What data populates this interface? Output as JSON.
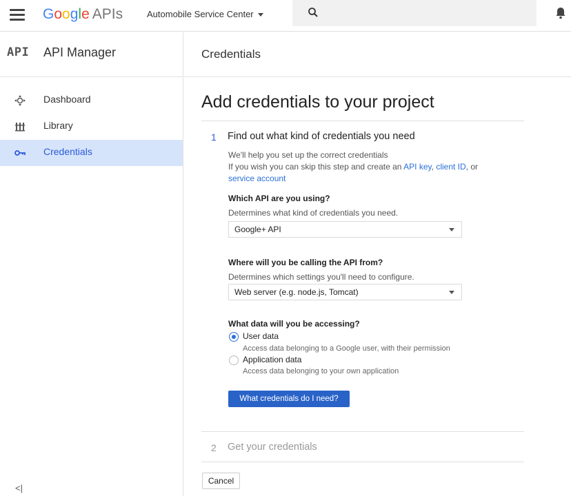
{
  "topbar": {
    "logo_google": "Google",
    "logo_apis": "APIs",
    "project_name": "Automobile Service Center"
  },
  "sidebar": {
    "logo_text": "API",
    "title": "API Manager",
    "items": [
      {
        "label": "Dashboard",
        "icon": "dashboard-icon",
        "active": false
      },
      {
        "label": "Library",
        "icon": "library-icon",
        "active": false
      },
      {
        "label": "Credentials",
        "icon": "key-icon",
        "active": true
      }
    ],
    "collapse_label": "<|"
  },
  "main": {
    "header_title": "Credentials",
    "page_title": "Add credentials to your project",
    "step1": {
      "number": "1",
      "title": "Find out what kind of credentials you need",
      "intro_line1": "We'll help you set up the correct credentials",
      "intro_line2_prefix": "If you wish you can skip this step and create an ",
      "link_api_key": "API key",
      "sep_comma": ",",
      "link_client_id": "client ID",
      "sep_or": ", or",
      "link_service_account": "service account",
      "q1_title": "Which API are you using?",
      "q1_desc": "Determines what kind of credentials you need.",
      "q1_value": "Google+ API",
      "q2_title": "Where will you be calling the API from?",
      "q2_desc": "Determines which settings you'll need to configure.",
      "q2_value": "Web server (e.g. node.js, Tomcat)",
      "q3_title": "What data will you be accessing?",
      "options": [
        {
          "label": "User data",
          "desc": "Access data belonging to a Google user, with their permission",
          "selected": true
        },
        {
          "label": "Application data",
          "desc": "Access data belonging to your own application",
          "selected": false
        }
      ],
      "button_label": "What credentials do I need?"
    },
    "step2": {
      "number": "2",
      "title": "Get your credentials"
    },
    "cancel_label": "Cancel"
  },
  "colors": {
    "accent": "#2a63c8",
    "active_nav_bg": "#d6e4fb",
    "link": "#2a6fd6"
  }
}
